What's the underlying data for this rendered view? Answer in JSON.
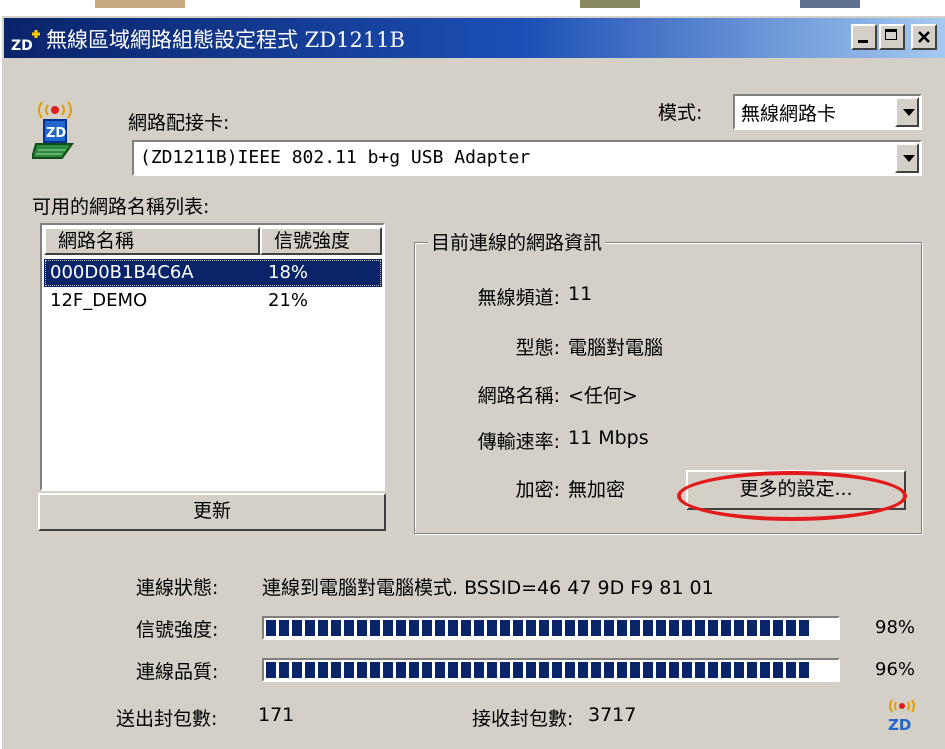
{
  "window": {
    "title": "無線區域網路組態設定程式  ZD1211B",
    "minimize_icon": "minimize-icon",
    "maximize_icon": "maximize-icon",
    "close_icon": "close-icon"
  },
  "adapter": {
    "label": "網路配接卡:",
    "value": "(ZD1211B)IEEE 802.11 b+g USB Adapter",
    "icon": "wireless-adapter-icon"
  },
  "mode": {
    "label": "模式:",
    "value": "無線網路卡"
  },
  "network_list": {
    "label": "可用的網路名稱列表:",
    "columns": [
      "網路名稱",
      "信號強度"
    ],
    "rows": [
      {
        "name": "000D0B1B4C6A",
        "signal": "18%",
        "selected": true
      },
      {
        "name": "12F_DEMO",
        "signal": "21%",
        "selected": false
      }
    ],
    "refresh_label": "更新"
  },
  "current_info": {
    "group_title": "目前連線的網路資訊",
    "channel_label": "無線頻道:",
    "channel_value": "11",
    "type_label": "型態:",
    "type_value": "電腦對電腦",
    "ssid_label": "網路名稱:",
    "ssid_value": "<任何>",
    "rate_label": "傳輸速率:",
    "rate_value": "11 Mbps",
    "encryption_label": "加密:",
    "encryption_value": "無加密",
    "more_settings_label": "更多的設定..."
  },
  "status": {
    "connection_label": "連線狀態:",
    "connection_value": "連線到電腦對電腦模式. BSSID=46 47 9D F9 81 01",
    "signal_label": "信號強度:",
    "signal_percent": "98%",
    "signal_level": 0.98,
    "quality_label": "連線品質:",
    "quality_percent": "96%",
    "quality_level": 0.96,
    "sent_label": "送出封包數:",
    "sent_value": "171",
    "received_label": "接收封包數:",
    "received_value": "3717",
    "logo_icon": "zd-logo-icon"
  },
  "colors": {
    "titlebar": "#0a246a",
    "selection": "#0a246a",
    "annotation": "#e31a1a",
    "face": "#d4d0c8"
  }
}
